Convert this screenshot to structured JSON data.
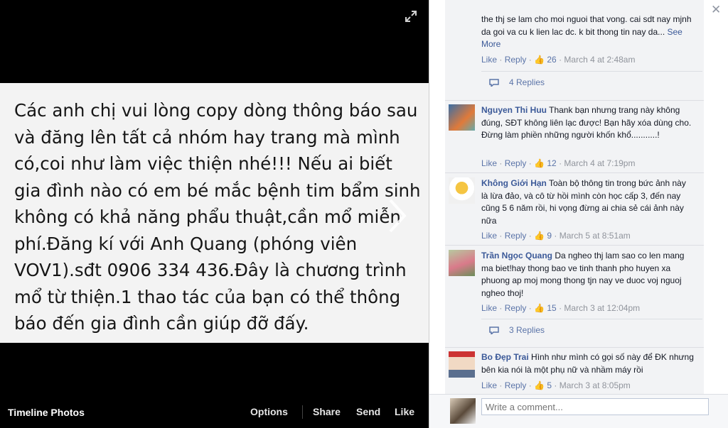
{
  "photo": {
    "text": "Các anh chị vui lòng copy dòng thông báo sau và đăng lên tất cả nhóm hay trang mà mình có,coi như làm việc thiện nhé!!! Nếu ai biết gia đình nào có em bé mắc bệnh tim bẩm sinh không có khả năng phẩu thuật,cần mổ miễn phí.Đăng kí với Anh Quang (phóng viên VOV1).sđt 0906 334 436.Đây là chương trình mổ từ thiện.1 thao tác của bạn có thể thông báo đến gia đình cần giúp đỡ đấy."
  },
  "bottom_bar": {
    "album_title": "Timeline Photos",
    "options": "Options",
    "share": "Share",
    "send": "Send",
    "like": "Like"
  },
  "actions": {
    "like": "Like",
    "reply": "Reply",
    "dot": "·"
  },
  "comments": [
    {
      "author": "",
      "text": "the thj se lam cho moi nguoi that vong. cai sdt nay mjnh da goi va cu k lien lac dc. k bit thong tin nay da...",
      "see_more": "See More",
      "likes": "26",
      "time": "March 4 at 2:48am",
      "replies": "4 Replies"
    },
    {
      "author": "Nguyen Thi Huu",
      "text": "Thank bạn nhưng trang này không đúng, SĐT không liên lạc được! Bạn hãy xóa dùng cho. Đừng làm phiền những người khốn khổ...........!",
      "likes": "12",
      "time": "March 4 at 7:19pm"
    },
    {
      "author": "Không Giới Hạn",
      "text": "Toàn bộ thông tin trong bức ảnh này là lừa đảo, và cô từ hồi mình còn học cấp 3, đến nay cũng 5 6 năm rồi, hi vọng đừng ai chia sẻ cái ảnh này nữa",
      "likes": "9",
      "time": "March 5 at 8:51am"
    },
    {
      "author": "Trần Ngọc Quang",
      "text": "Da ngheo thj lam sao co len mang ma biet!hay thong bao ve tinh thanh pho huyen xa phuong ap moj mong thong tjn nay ve duoc voj nguoj ngheo thoj!",
      "likes": "15",
      "time": "March 3 at 12:04pm",
      "replies": "3 Replies"
    },
    {
      "author": "Bo Đẹp Trai",
      "text": "Hình như mình có gọi số này để ĐK nhưng bên kia nói là một phụ nữ và nhầm máy rồi",
      "likes": "5",
      "time": "March 3 at 8:05pm"
    }
  ],
  "compose": {
    "placeholder": "Write a comment..."
  },
  "icons": {
    "close": "close-icon",
    "expand": "expand-icon",
    "next": "chevron-right-icon",
    "like_thumb": "thumbs-up-icon",
    "reply": "speech-bubble-icon"
  }
}
